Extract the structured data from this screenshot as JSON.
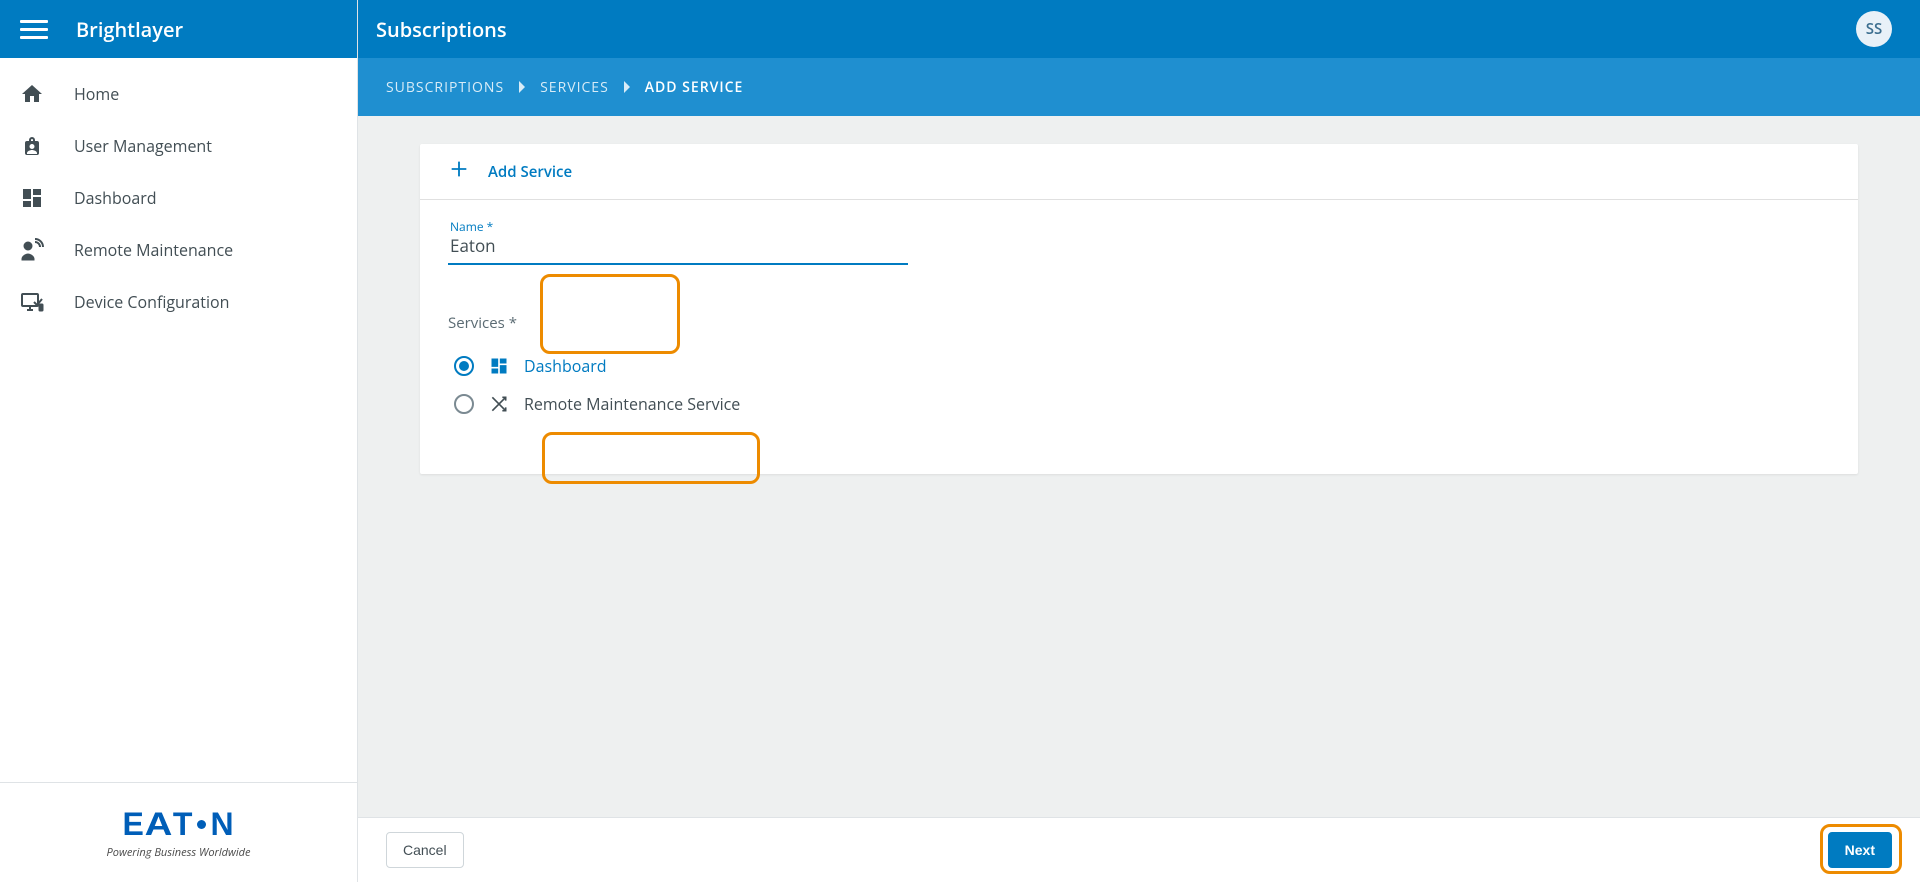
{
  "app": {
    "title": "Brightlayer"
  },
  "user": {
    "initials": "SS"
  },
  "sidebar": {
    "items": [
      {
        "icon": "home-icon",
        "label": "Home"
      },
      {
        "icon": "user-mgmt-icon",
        "label": "User Management"
      },
      {
        "icon": "dashboard-icon",
        "label": "Dashboard"
      },
      {
        "icon": "remote-maint-icon",
        "label": "Remote Maintenance"
      },
      {
        "icon": "device-config-icon",
        "label": "Device Configuration"
      }
    ],
    "logo_brand": "EATON",
    "logo_tagline": "Powering Business Worldwide"
  },
  "header": {
    "page_title": "Subscriptions"
  },
  "breadcrumb": {
    "items": [
      {
        "label": "SUBSCRIPTIONS",
        "current": false
      },
      {
        "label": "SERVICES",
        "current": false
      },
      {
        "label": "ADD SERVICE",
        "current": true
      }
    ]
  },
  "card": {
    "title": "Add Service",
    "name_field": {
      "label": "Name *",
      "value": "Eaton"
    },
    "services_label": "Services *",
    "services": [
      {
        "icon": "dashboard-icon",
        "label": "Dashboard",
        "selected": true
      },
      {
        "icon": "shuffle-icon",
        "label": "Remote Maintenance Service",
        "selected": false
      }
    ]
  },
  "footer": {
    "cancel": "Cancel",
    "next": "Next"
  },
  "colors": {
    "primary": "#007bc1",
    "highlight": "#ed8b00"
  }
}
